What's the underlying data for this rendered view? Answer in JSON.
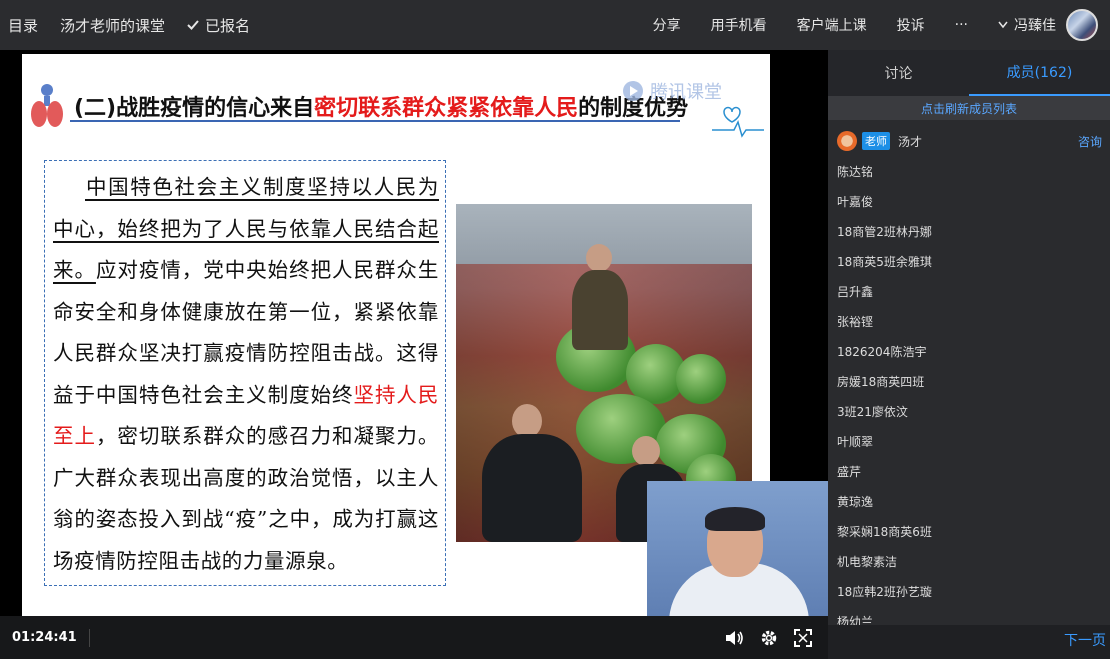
{
  "topbar": {
    "catalog": "目录",
    "classroom": "汤才老师的课堂",
    "enrolled": "已报名",
    "share": "分享",
    "mobile": "用手机看",
    "client": "客户端上课",
    "complain": "投诉",
    "more": "···",
    "user": "冯臻佳"
  },
  "slide": {
    "title_part1": "(二)战胜疫情的信心来自",
    "title_red": "密切联系群众紧紧依靠人民",
    "title_part2": "的制度优势",
    "watermark": "腾讯课堂",
    "para_ul": "中国特色社会主义制度坚持以人民为中心，始终把为了人民与依靠人民结合起来。",
    "para_a": "应对疫情，党中央始终把人民群众生命安全和身体健康放在第一位，紧紧依靠人民群众坚决打赢疫情防控阻击战。这得益于中国特色社会主义制度始终",
    "para_red": "坚持人民至上",
    "para_b": "，密切联系群众的感召力和凝聚力。广大群众表现出高度的政治觉悟，以主人翁的姿态投入到战“疫”之中，成为打赢这场疫情防控阻击战的力量源泉。"
  },
  "player": {
    "time": "01:24:41"
  },
  "panel": {
    "tab_discuss": "讨论",
    "tab_members": "成员(162)",
    "refresh": "点击刷新成员列表",
    "teacher_badge": "老师",
    "teacher_name": "汤才",
    "consult": "咨询",
    "members": [
      "陈达铭",
      "叶嘉俊",
      "18商管2班林丹娜",
      "18商英5班余雅琪",
      "吕升鑫",
      "张裕铿",
      "1826204陈浩宇",
      "房媛18商英四班",
      "3班21廖依汶",
      "叶顺翠",
      "盛芹",
      "黄琼逸",
      "黎采娴18商英6班",
      "机电黎素洁",
      "18应韩2班孙艺璇",
      "杨幼兰"
    ],
    "next_page": "下一页"
  }
}
